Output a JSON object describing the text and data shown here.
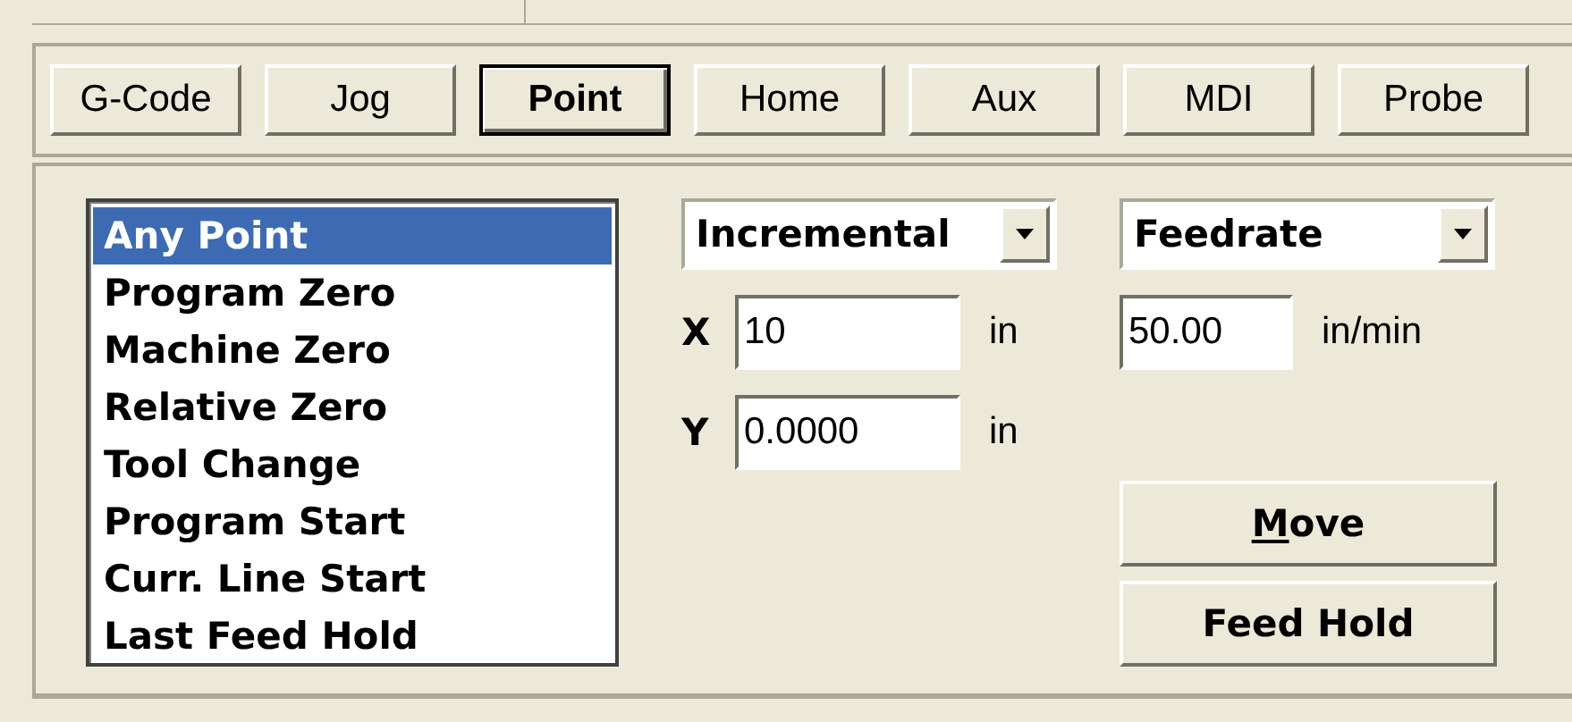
{
  "tabs": [
    {
      "label": "G-Code",
      "selected": false
    },
    {
      "label": "Jog",
      "selected": false
    },
    {
      "label": "Point",
      "selected": true
    },
    {
      "label": "Home",
      "selected": false
    },
    {
      "label": "Aux",
      "selected": false
    },
    {
      "label": "MDI",
      "selected": false
    },
    {
      "label": "Probe",
      "selected": false
    }
  ],
  "point_list": [
    {
      "label": "Any Point",
      "selected": true
    },
    {
      "label": "Program Zero",
      "selected": false
    },
    {
      "label": "Machine Zero",
      "selected": false
    },
    {
      "label": "Relative Zero",
      "selected": false
    },
    {
      "label": "Tool Change",
      "selected": false
    },
    {
      "label": "Program Start",
      "selected": false
    },
    {
      "label": "Curr. Line Start",
      "selected": false
    },
    {
      "label": "Last Feed Hold",
      "selected": false
    }
  ],
  "mode_dropdown": {
    "value": "Incremental"
  },
  "axes": [
    {
      "label": "X",
      "value": "10",
      "unit": "in"
    },
    {
      "label": "Y",
      "value": "0.0000",
      "unit": "in"
    }
  ],
  "rate_dropdown": {
    "value": "Feedrate"
  },
  "rate": {
    "value": "50.00",
    "unit": "in/min"
  },
  "buttons": [
    {
      "label": "Move",
      "kind": "accel"
    },
    {
      "label": "Feed Hold",
      "kind": "plain"
    }
  ]
}
